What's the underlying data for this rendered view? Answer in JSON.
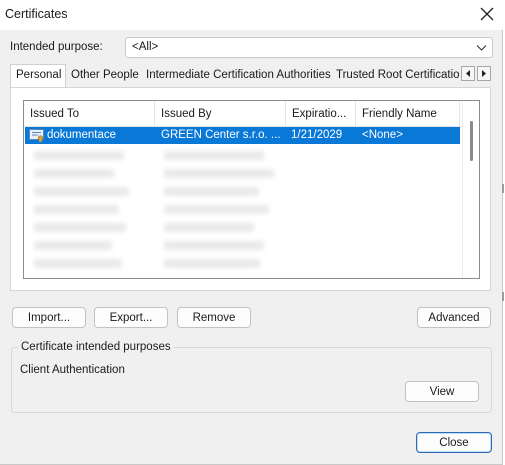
{
  "window": {
    "title": "Certificates"
  },
  "purpose": {
    "label": "Intended purpose:",
    "value": "<All>"
  },
  "tabs": [
    {
      "label": "Personal",
      "active": true
    },
    {
      "label": "Other People",
      "active": false
    },
    {
      "label": "Intermediate Certification Authorities",
      "active": false
    },
    {
      "label": "Trusted Root Certification Authorities",
      "active": false
    }
  ],
  "list": {
    "columns": [
      "Issued To",
      "Issued By",
      "Expiratio...",
      "Friendly Name"
    ],
    "selected_row": {
      "issued_to": "dokumentace",
      "issued_by": "GREEN Center s.r.o. ...",
      "expiration": "1/21/2029",
      "friendly_name": "<None>"
    }
  },
  "buttons": {
    "import": "Import...",
    "export": "Export...",
    "remove": "Remove",
    "advanced": "Advanced",
    "view": "View",
    "close": "Close"
  },
  "purposes_group": {
    "title": "Certificate intended purposes",
    "text": "Client Authentication"
  },
  "colors": {
    "selection": "#0a78d7",
    "window_bg": "#f0f0f0",
    "default_button_border": "#2c6ab8"
  },
  "icons": {
    "close": "close-icon",
    "dropdown": "chevron-down-icon",
    "certificate": "certificate-icon",
    "scroll_left": "scroll-left-icon",
    "scroll_right": "scroll-right-icon"
  }
}
